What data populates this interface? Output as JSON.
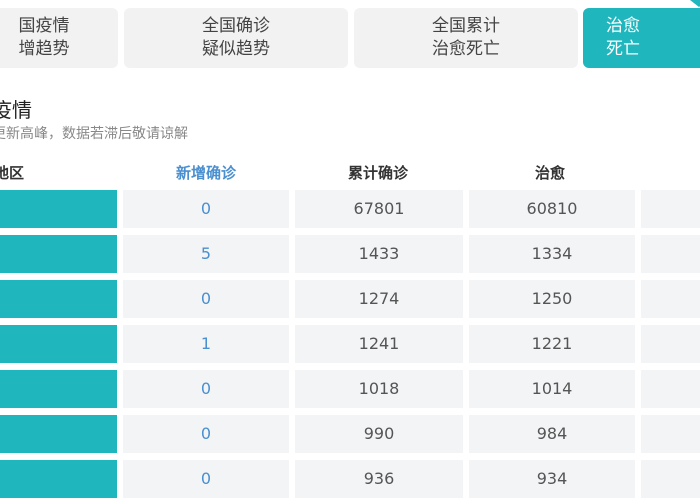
{
  "colors": {
    "accent": "#1fb6bd",
    "tab_bg": "#f2f2f2",
    "cell_bg": "#f3f4f6",
    "link_blue": "#4a8fd0"
  },
  "tabs": [
    {
      "line1": "国疫情",
      "line2": "增趋势",
      "active": false
    },
    {
      "line1": "全国确诊",
      "line2": "疑似趋势",
      "active": false
    },
    {
      "line1": "全国累计",
      "line2": "治愈死亡",
      "active": false
    },
    {
      "line1": "治愈",
      "line2": "死亡",
      "active": true
    }
  ],
  "section": {
    "title": "疫情",
    "subtitle": "更新高峰，数据若滞后敬请谅解"
  },
  "table": {
    "headers": {
      "region": "地区",
      "new_confirmed": "新增确诊",
      "total_confirmed": "累计确诊",
      "cured": "治愈"
    },
    "rows": [
      {
        "region": "",
        "new_confirmed": "0",
        "total_confirmed": "67801",
        "cured": "60810"
      },
      {
        "region": "",
        "new_confirmed": "5",
        "total_confirmed": "1433",
        "cured": "1334"
      },
      {
        "region": "",
        "new_confirmed": "0",
        "total_confirmed": "1274",
        "cured": "1250"
      },
      {
        "region": "",
        "new_confirmed": "1",
        "total_confirmed": "1241",
        "cured": "1221"
      },
      {
        "region": "",
        "new_confirmed": "0",
        "total_confirmed": "1018",
        "cured": "1014"
      },
      {
        "region": "",
        "new_confirmed": "0",
        "total_confirmed": "990",
        "cured": "984"
      },
      {
        "region": "",
        "new_confirmed": "0",
        "total_confirmed": "936",
        "cured": "934"
      }
    ]
  }
}
